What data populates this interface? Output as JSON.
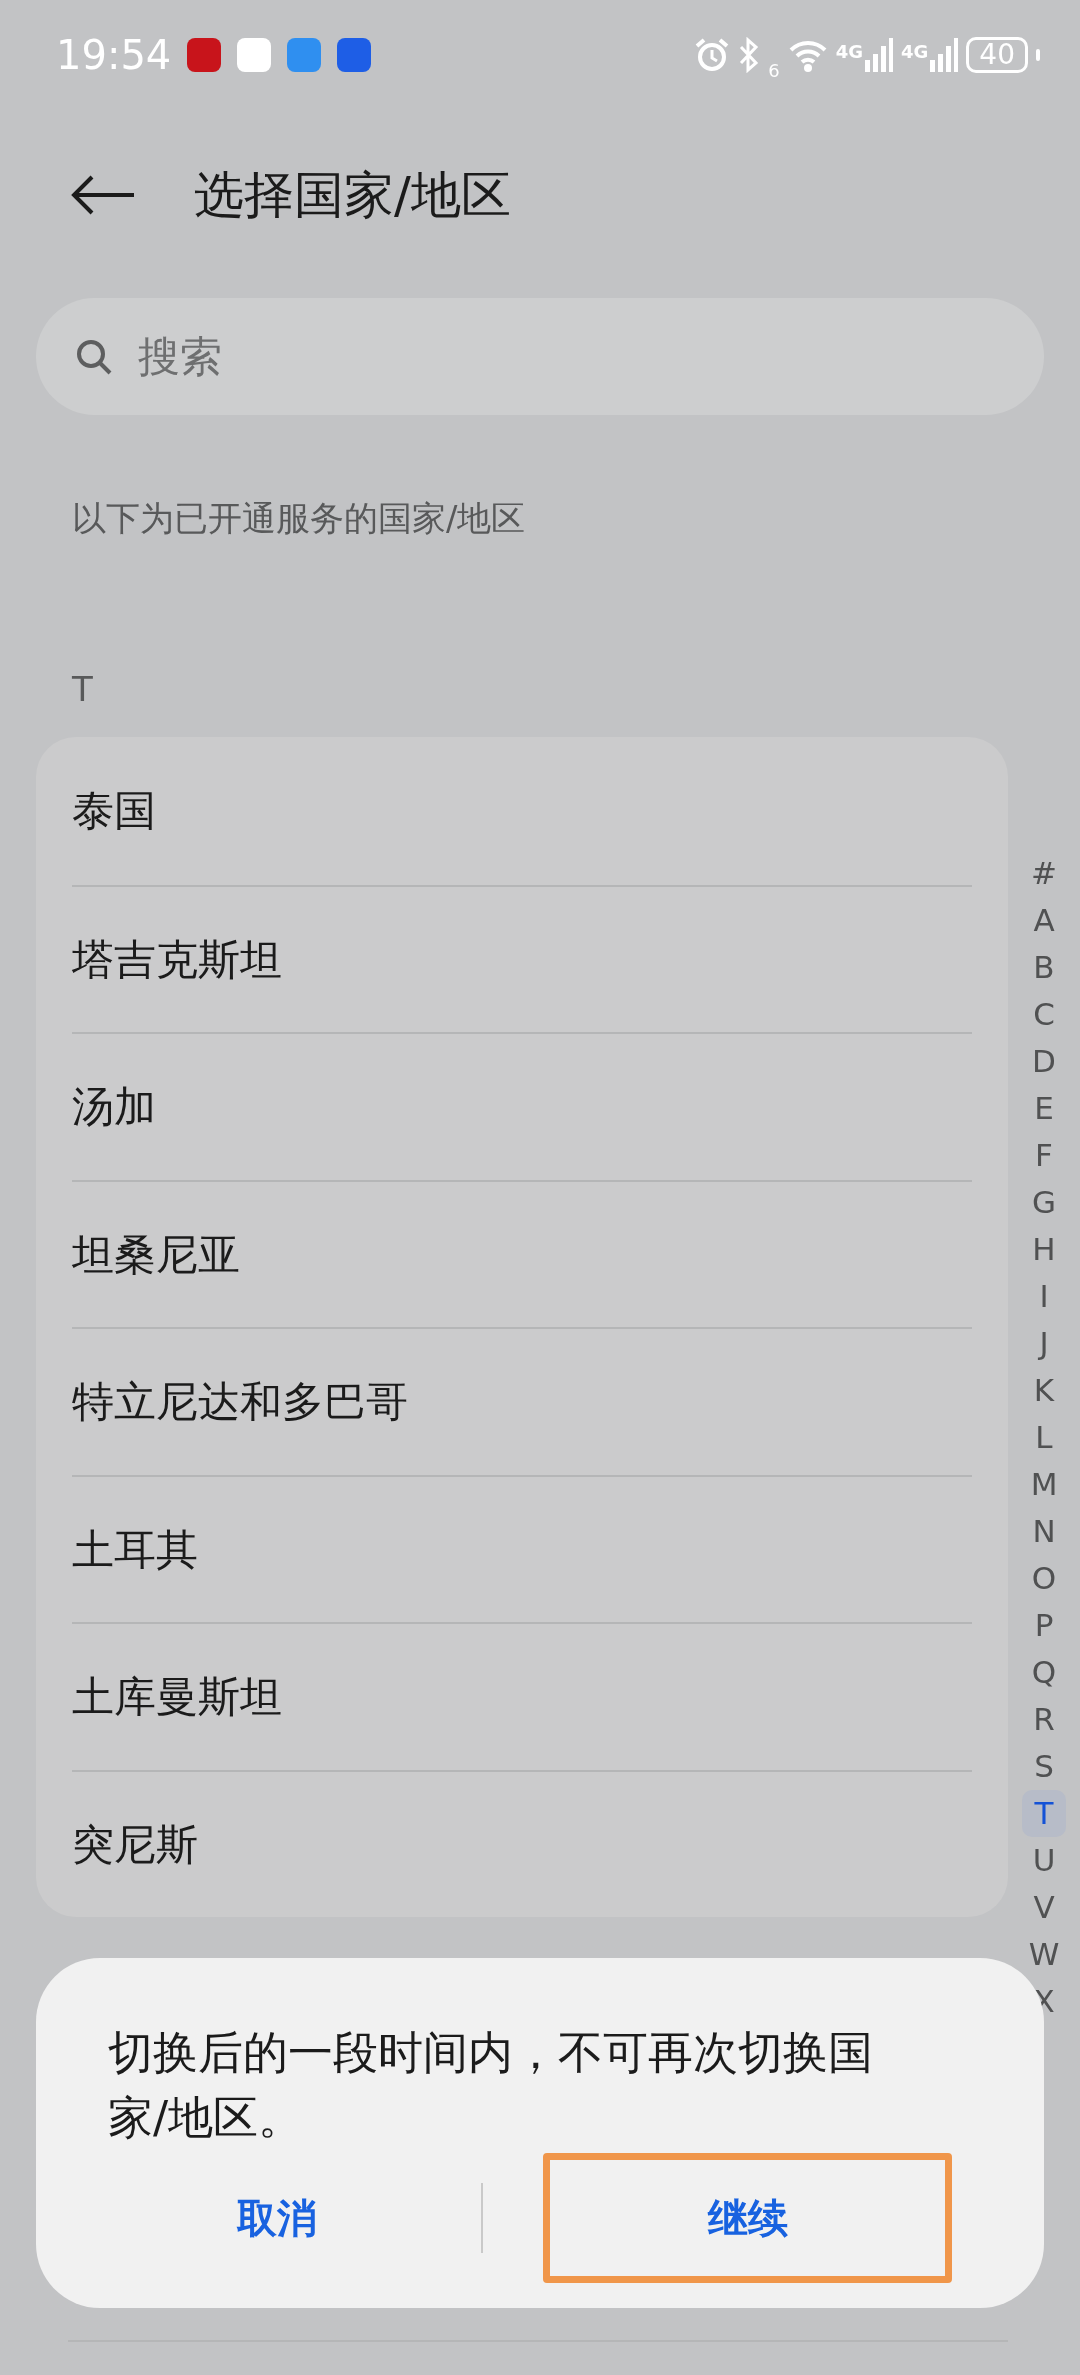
{
  "status_bar": {
    "time": "19:54",
    "apps": [
      {
        "color": "#c8141b"
      },
      {
        "color": "#ffffff"
      },
      {
        "color": "#2f8ff0"
      },
      {
        "color": "#1e5ee6"
      }
    ],
    "wifi_label": "6",
    "networks": [
      "4G",
      "4G"
    ],
    "battery": "40"
  },
  "header": {
    "title": "选择国家/地区"
  },
  "search": {
    "placeholder": "搜索"
  },
  "subtitle": "以下为已开通服务的国家/地区",
  "section": {
    "letter": "T",
    "items": [
      "泰国",
      "塔吉克斯坦",
      "汤加",
      "坦桑尼亚",
      "特立尼达和多巴哥",
      "土耳其",
      "土库曼斯坦",
      "突尼斯"
    ]
  },
  "index": [
    {
      "letter": "#",
      "selected": false
    },
    {
      "letter": "A",
      "selected": false
    },
    {
      "letter": "B",
      "selected": false
    },
    {
      "letter": "C",
      "selected": false
    },
    {
      "letter": "D",
      "selected": false
    },
    {
      "letter": "E",
      "selected": false
    },
    {
      "letter": "F",
      "selected": false
    },
    {
      "letter": "G",
      "selected": false
    },
    {
      "letter": "H",
      "selected": false
    },
    {
      "letter": "I",
      "selected": false
    },
    {
      "letter": "J",
      "selected": false
    },
    {
      "letter": "K",
      "selected": false
    },
    {
      "letter": "L",
      "selected": false
    },
    {
      "letter": "M",
      "selected": false
    },
    {
      "letter": "N",
      "selected": false
    },
    {
      "letter": "O",
      "selected": false
    },
    {
      "letter": "P",
      "selected": false
    },
    {
      "letter": "Q",
      "selected": false
    },
    {
      "letter": "R",
      "selected": false
    },
    {
      "letter": "S",
      "selected": false
    },
    {
      "letter": "T",
      "selected": true
    },
    {
      "letter": "U",
      "selected": false
    },
    {
      "letter": "V",
      "selected": false
    },
    {
      "letter": "W",
      "selected": false
    },
    {
      "letter": "X",
      "selected": false
    }
  ],
  "dialog": {
    "message": "切换后的一段时间内，不可再次切换国家/地区。",
    "buttons": [
      {
        "label": "取消",
        "highlighted": false
      },
      {
        "label": "继续",
        "highlighted": true
      }
    ]
  }
}
